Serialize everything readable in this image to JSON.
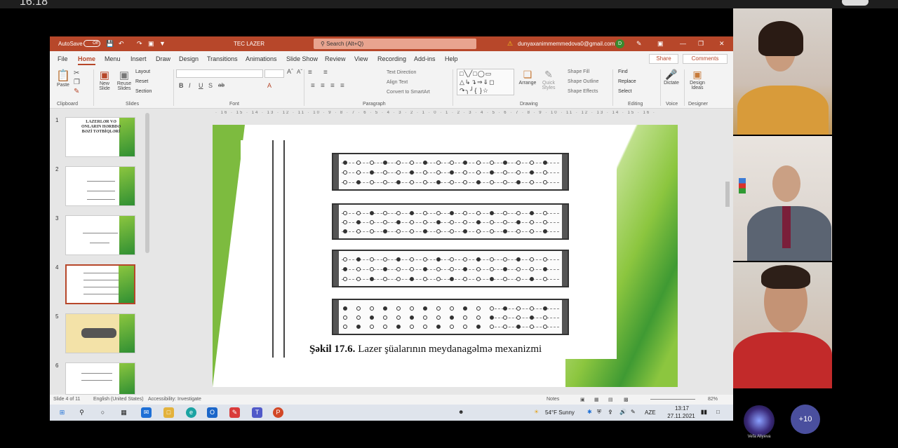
{
  "teams": {
    "clock": "16:18"
  },
  "window": {
    "autosave": "AutoSave",
    "autosave_state": "Off",
    "doc_title": "TEC LAZER",
    "search_placeholder": "Search (Alt+Q)",
    "account": "dunyaxanimmemmedova0@gmail.com",
    "account_initial": "D"
  },
  "menu": {
    "tabs": [
      "File",
      "Home",
      "Menu",
      "Insert",
      "Draw",
      "Design",
      "Transitions",
      "Animations",
      "Slide Show",
      "Review",
      "View",
      "Recording",
      "Add-ins",
      "Help"
    ],
    "share": "Share",
    "comments": "Comments"
  },
  "ribbon": {
    "groups": [
      "Clipboard",
      "Slides",
      "Font",
      "Paragraph",
      "Drawing",
      "Editing",
      "Voice",
      "Designer"
    ],
    "paste": "Paste",
    "new_slide": "New Slide",
    "reuse_slides": "Reuse Slides",
    "layout": "Layout",
    "reset": "Reset",
    "section": "Section",
    "text_direction": "Text Direction",
    "align_text": "Align Text",
    "convert_smartart": "Convert to SmartArt",
    "arrange": "Arrange",
    "quick_styles": "Quick Styles",
    "shape_fill": "Shape Fill",
    "shape_outline": "Shape Outline",
    "shape_effects": "Shape Effects",
    "find": "Find",
    "replace": "Replace",
    "select": "Select",
    "dictate": "Dictate",
    "design_ideas": "Design Ideas"
  },
  "slides": {
    "numbers": [
      "1",
      "2",
      "3",
      "4",
      "5",
      "6"
    ],
    "thumb1_text": "LAZERLƏR VƏ ONLARIN HƏRBDƏ BƏZİ TƏTBİQLƏRİ"
  },
  "ruler": "· 16 · 15 · 14 · 13 · 12 · 11 · 10 · 9 · 8 · 7 · 6 · 5 · 4 · 3 · 2 · 1 · 0 · 1 · 2 · 3 · 4 · 5 · 6 · 7 · 8 · 9 · 10 · 11 · 12 · 13 · 14 · 15 · 16 ·",
  "slide": {
    "caption_bold": "Şəkil 17.6.",
    "caption_rest": " Lazer şüalarının meydanagəlmə mexanizmi"
  },
  "status": {
    "slide_of": "Slide 4 of 11",
    "language": "English (United States)",
    "accessibility": "Accessibility: Investigate",
    "notes": "Notes",
    "zoom": "82%"
  },
  "taskbar": {
    "weather": "54°F  Sunny",
    "lang": "AZE",
    "time": "13:17",
    "date": "27.11.2021"
  },
  "participants": {
    "remote_name": "Vefa Aliyeva",
    "more": "+10"
  },
  "colors": {
    "ppt_accent": "#b7472a",
    "slide_green": "#7dbb3f"
  }
}
